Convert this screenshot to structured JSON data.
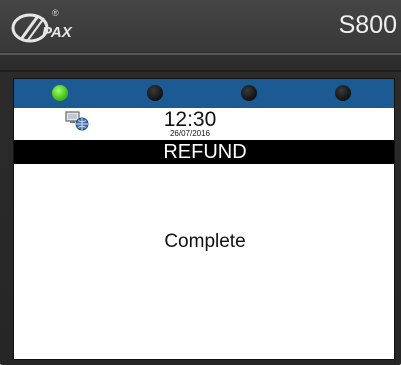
{
  "header": {
    "brand": "PAX",
    "registered_mark": "®",
    "model": "S800"
  },
  "screen": {
    "leds": [
      {
        "state": "on",
        "color": "#4fc421"
      },
      {
        "state": "off",
        "color": "#111111"
      },
      {
        "state": "off",
        "color": "#111111"
      },
      {
        "state": "off",
        "color": "#111111"
      }
    ],
    "status": {
      "network_icon": "network-globe-icon",
      "time": "12:30",
      "date": "26/07/2016"
    },
    "title": "REFUND",
    "message": "Complete"
  },
  "colors": {
    "led_bar": "#1b5a92",
    "title_bar": "#000000",
    "bezel": "#333333"
  }
}
